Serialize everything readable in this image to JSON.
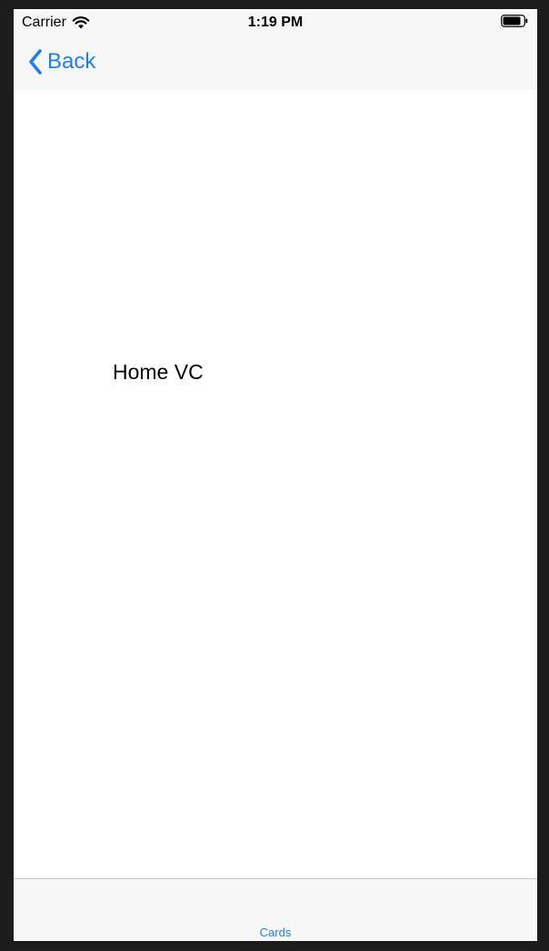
{
  "status_bar": {
    "carrier": "Carrier",
    "time": "1:19 PM",
    "wifi_icon": "wifi-icon",
    "battery_icon": "battery-icon"
  },
  "nav_bar": {
    "back_label": "Back",
    "back_icon": "chevron-left-icon"
  },
  "main": {
    "label": "Home VC"
  },
  "tab_bar": {
    "items": [
      {
        "label": "Cards",
        "selected": true
      }
    ]
  },
  "colors": {
    "accent": "#1f7fe6",
    "bar_background": "#f7f7f7",
    "outer_background": "#1c1c1c"
  }
}
